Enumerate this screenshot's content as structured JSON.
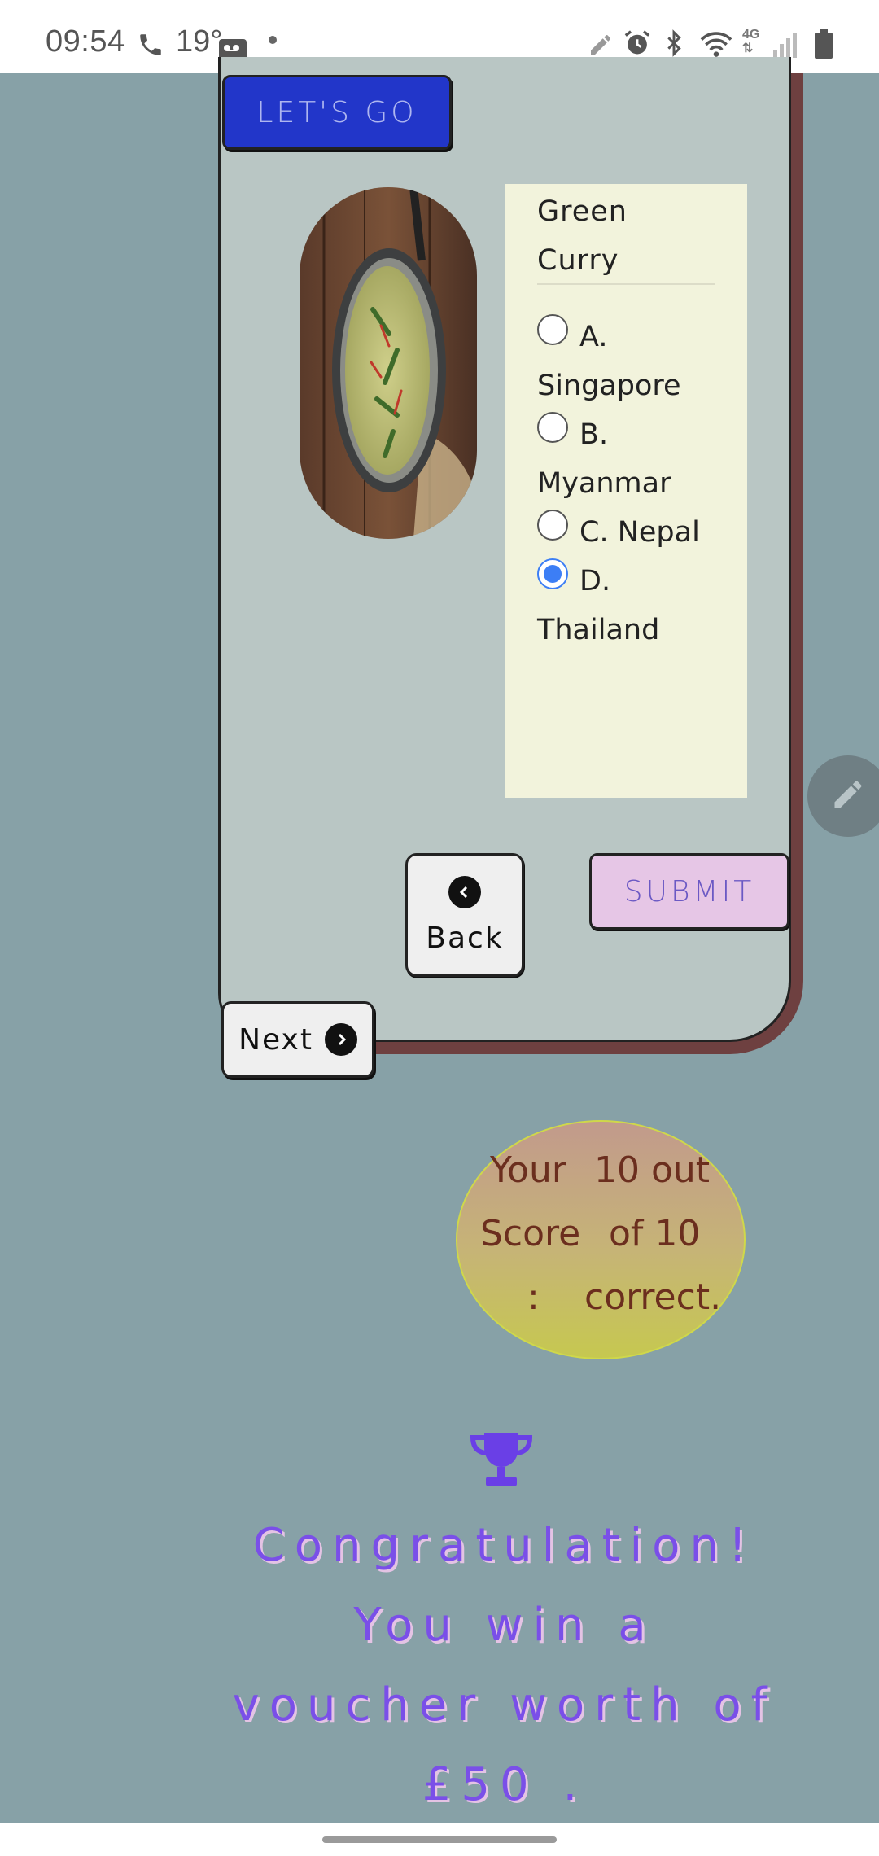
{
  "status_bar": {
    "time": "09:54",
    "temperature": "19°",
    "icons": [
      "phone-icon",
      "voicemail-icon",
      "pen-icon",
      "alarm-icon",
      "bluetooth-icon",
      "wifi-icon",
      "4g-icon",
      "signal-icon",
      "battery-icon"
    ]
  },
  "quiz": {
    "lets_go_label": "LET'S GO",
    "dish_name": "Green Curry",
    "options": [
      {
        "label": "A. Singapore",
        "checked": false
      },
      {
        "label": "B. Myanmar",
        "checked": false
      },
      {
        "label": "C. Nepal",
        "checked": false
      },
      {
        "label": "D. Thailand",
        "checked": true
      }
    ],
    "back_label": "Back",
    "submit_label": "SUBMIT",
    "next_label": "Next"
  },
  "score": {
    "line1_a": "Your",
    "line1_b": "10 out",
    "line2_a": "Score",
    "line2_b": "of 10",
    "line3_a": ":",
    "line3_b": "correct."
  },
  "congratulation": {
    "line1": "Congratulation!",
    "line2": "You win a",
    "line3": "voucher worth of",
    "line4": "£50 ."
  },
  "colors": {
    "background": "#87a1a7",
    "card": "#b9c6c4",
    "lets_go": "#2236c9",
    "submit": "#e6c6e6",
    "congrats_text": "#7a4fe8"
  }
}
